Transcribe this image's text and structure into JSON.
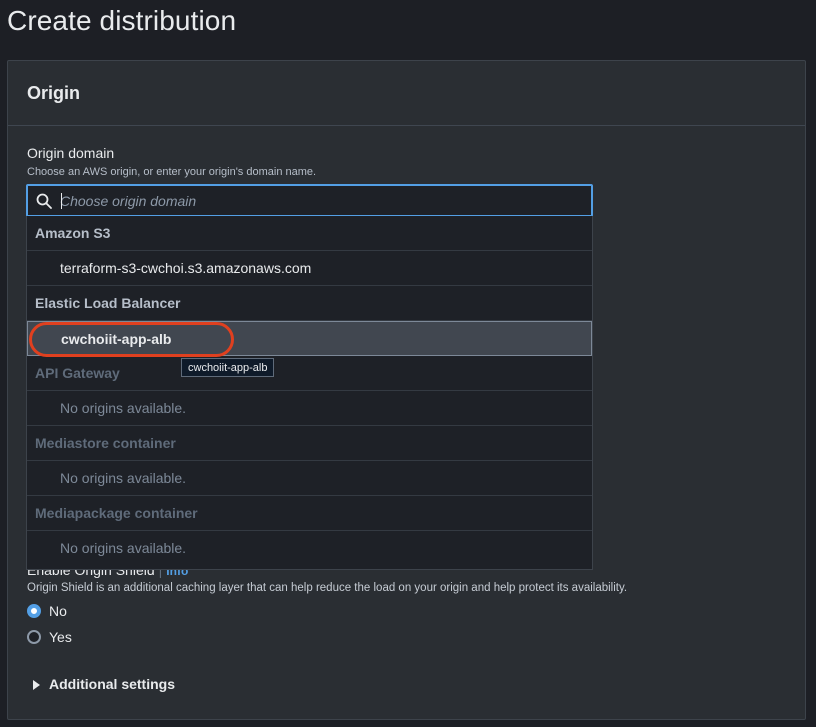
{
  "page": {
    "title": "Create distribution"
  },
  "origin": {
    "section_title": "Origin",
    "domain_label": "Origin domain",
    "domain_description": "Choose an AWS origin, or enter your origin's domain name.",
    "search_placeholder": "Choose origin domain",
    "search_value": ""
  },
  "dropdown": {
    "groups": [
      {
        "label": "Amazon S3",
        "options": [
          "terraform-s3-cwchoi.s3.amazonaws.com"
        ]
      },
      {
        "label": "Elastic Load Balancer",
        "options": [
          "cwchoiit-app-alb"
        ]
      },
      {
        "label": "API Gateway",
        "options": [
          "No origins available."
        ]
      },
      {
        "label": "Mediastore container",
        "options": [
          "No origins available."
        ]
      },
      {
        "label": "Mediapackage container",
        "options": [
          "No origins available."
        ]
      }
    ],
    "tooltip": "cwchoiit-app-alb"
  },
  "origin_shield": {
    "label": "Enable Origin Shield",
    "info_link": "Info",
    "description": "Origin Shield is an additional caching layer that can help reduce the load on your origin and help protect its availability.",
    "options": [
      {
        "label": "No",
        "selected": true
      },
      {
        "label": "Yes",
        "selected": false
      }
    ]
  },
  "additional_settings": {
    "label": "Additional settings"
  },
  "colors": {
    "accent": "#539fe5",
    "annotation": "#e0401f",
    "panel_bg": "#2a2e33",
    "page_bg": "#1d1f25"
  }
}
